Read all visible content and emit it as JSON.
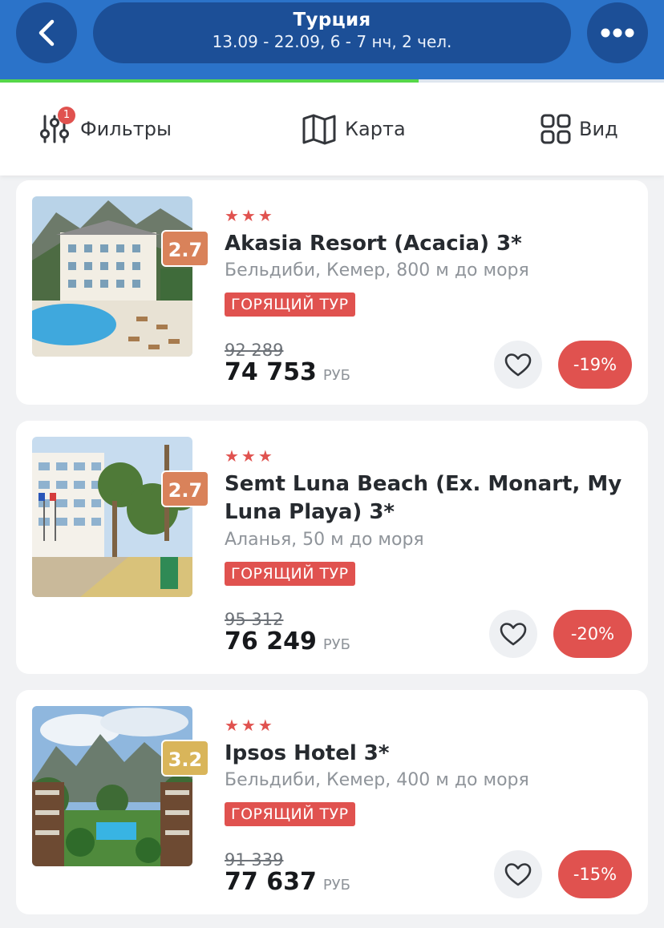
{
  "header": {
    "destination": "Турция",
    "details": "13.09 - 22.09, 6 - 7 нч, 2 чел.",
    "loading_progress": 0.63
  },
  "toolbar": {
    "filters_label": "Фильтры",
    "filters_badge": "1",
    "map_label": "Карта",
    "view_label": "Вид"
  },
  "hotels": [
    {
      "rating": "2.7",
      "rating_color": "#d9825a",
      "stars": "★★★",
      "name": "Akasia Resort (Acacia) 3*",
      "location": "Бельдиби, Кемер, 800 м до моря",
      "tag": "ГОРЯЩИЙ ТУР",
      "old_price": "92 289",
      "price": "74 753",
      "currency": "РУБ",
      "discount": "-19%"
    },
    {
      "rating": "2.7",
      "rating_color": "#d9825a",
      "stars": "★★★",
      "name": "Semt Luna Beach (Ex. Monart, My Luna Playa) 3*",
      "location": "Аланья, 50 м до моря",
      "tag": "ГОРЯЩИЙ ТУР",
      "old_price": "95 312",
      "price": "76 249",
      "currency": "РУБ",
      "discount": "-20%"
    },
    {
      "rating": "3.2",
      "rating_color": "#d9b55a",
      "stars": "★★★",
      "name": "Ipsos Hotel 3*",
      "location": "Бельдиби, Кемер, 400 м до моря",
      "tag": "ГОРЯЩИЙ ТУР",
      "old_price": "91 339",
      "price": "77 637",
      "currency": "РУБ",
      "discount": "-15%"
    }
  ],
  "colors": {
    "header_bg": "#2b73c9",
    "pill_bg": "#1c4f97",
    "progress": "#56d84a",
    "accent_red": "#e0524f"
  }
}
